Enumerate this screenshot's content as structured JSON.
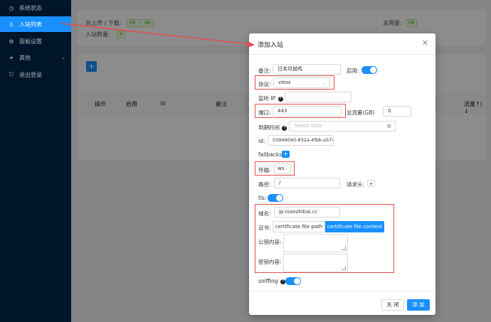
{
  "sidebar": {
    "items": [
      {
        "label": "系统状态",
        "icon": "dashboard-icon"
      },
      {
        "label": "入站列表",
        "icon": "user-icon"
      },
      {
        "label": "面板设置",
        "icon": "gear-icon"
      },
      {
        "label": "其他",
        "icon": "link-icon"
      },
      {
        "label": "退出登录",
        "icon": "logout-icon"
      }
    ]
  },
  "stats": {
    "traffic_label": "总上传 / 下载:",
    "traffic_value": "0B / 0B",
    "count_label": "入站数量:",
    "count_value": "0",
    "usage_label": "总用量:",
    "usage_value": "0B"
  },
  "table": {
    "add_label": "+",
    "columns": [
      "操作",
      "启用",
      "id",
      "备注",
      "流量↑|↓"
    ]
  },
  "modal": {
    "title": "添加入站",
    "close": "✕",
    "remark_label": "备注:",
    "remark_value": "日本月抛鸡",
    "enable_label": "启用:",
    "protocol_label": "协议:",
    "protocol_value": "vless",
    "listen_label": "监听 IP",
    "port_label": "端口:",
    "port_value": "443",
    "total_label": "总流量(GB)",
    "total_value": "0",
    "expire_label": "到期时间",
    "expire_placeholder": "Select date",
    "id_label": "id:",
    "id_value": "03949040-832a-4fbb-a574",
    "fallbacks_label": "fallbacks:",
    "network_label": "传输:",
    "network_value": "ws",
    "path_label": "路径:",
    "path_value": "/",
    "headers_label": "请求头:",
    "tls_label": "tls:",
    "domain_label": "域名:",
    "domain_value": "jp.nianzhibai.cc",
    "cert_label": "证书:",
    "cert_path_btn": "certificate file path",
    "cert_content_btn": "certificate file content",
    "public_key_label": "公钥内容:",
    "private_key_label": "密钥内容:",
    "sniffing_label": "sniffing",
    "cancel_label": "关 闭",
    "ok_label": "添 加"
  },
  "colors": {
    "accent": "#1890ff",
    "annotation": "#e84c4c",
    "sidebar": "#001529"
  }
}
